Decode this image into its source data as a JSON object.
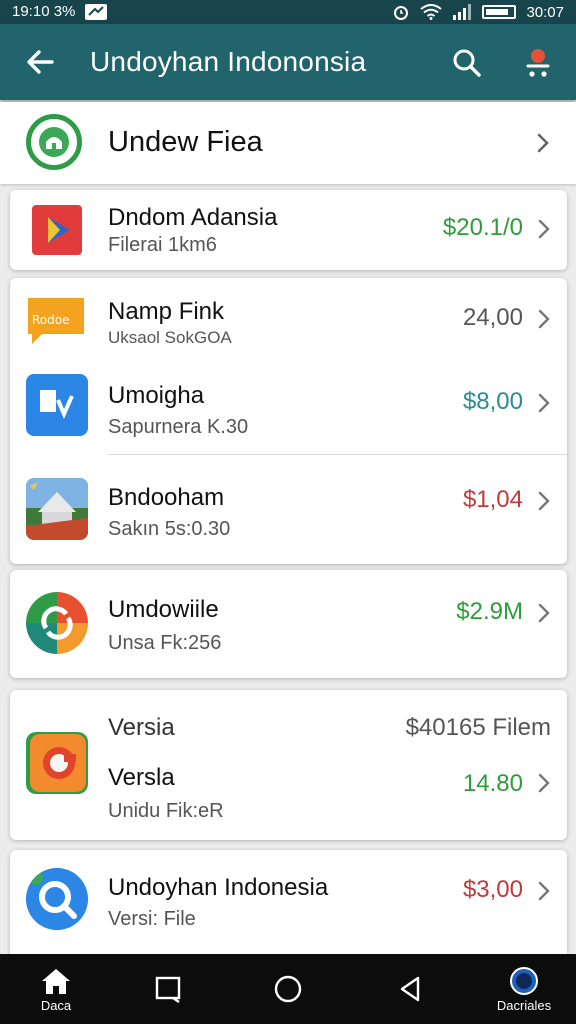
{
  "status_bar": {
    "left_text": "19:10 3%",
    "time": "30:07"
  },
  "app_bar": {
    "title": "Undoyhan Indononsia"
  },
  "header": {
    "label": "Undew Fiea"
  },
  "items": [
    {
      "title": "Dndom Adansia",
      "subtitle": "Filerai 1km6",
      "price": "$20.1/0",
      "price_color": "#2e9c3a",
      "icon": "play-store-icon"
    },
    {
      "title": "Namp Fink",
      "subtitle": "Uksaol SokGOA",
      "price": "24,00",
      "price_color": "#555555",
      "icon": "chat-bubble-icon"
    },
    {
      "title": "Umoigha",
      "subtitle": "Sapurnera K.30",
      "price": "$8,00",
      "price_color": "#2b8b94",
      "icon": "blue-app-icon"
    },
    {
      "title": "Bndooham",
      "subtitle": "Sakın 5s:0.30",
      "price": "$1,04",
      "price_color": "#c0393b",
      "icon": "landmark-photo-icon"
    },
    {
      "title": "Umdowiile",
      "subtitle": "Unsa Fk:256",
      "price": "$2.9M",
      "price_color": "#2e9c3a",
      "icon": "refresh-icon"
    },
    {
      "heading": "Versia",
      "heading_right": "$40165 Filem",
      "title": "Versla",
      "subtitle": "Unidu Fik:eR",
      "price": "14.80",
      "price_color": "#2e9c3a",
      "icon": "orange-ring-icon"
    },
    {
      "title": "Undoyhan Indonesia",
      "subtitle": "Versi: File",
      "price": "$3,00",
      "price_color": "#c0393b",
      "icon": "magnifier-app-icon"
    }
  ],
  "nav_bar": {
    "home_label": "Daca",
    "right_label": "Dacriales"
  },
  "colors": {
    "status_bar": "#17454b",
    "app_bar": "#22646c",
    "notification_dot": "#e2533a"
  }
}
